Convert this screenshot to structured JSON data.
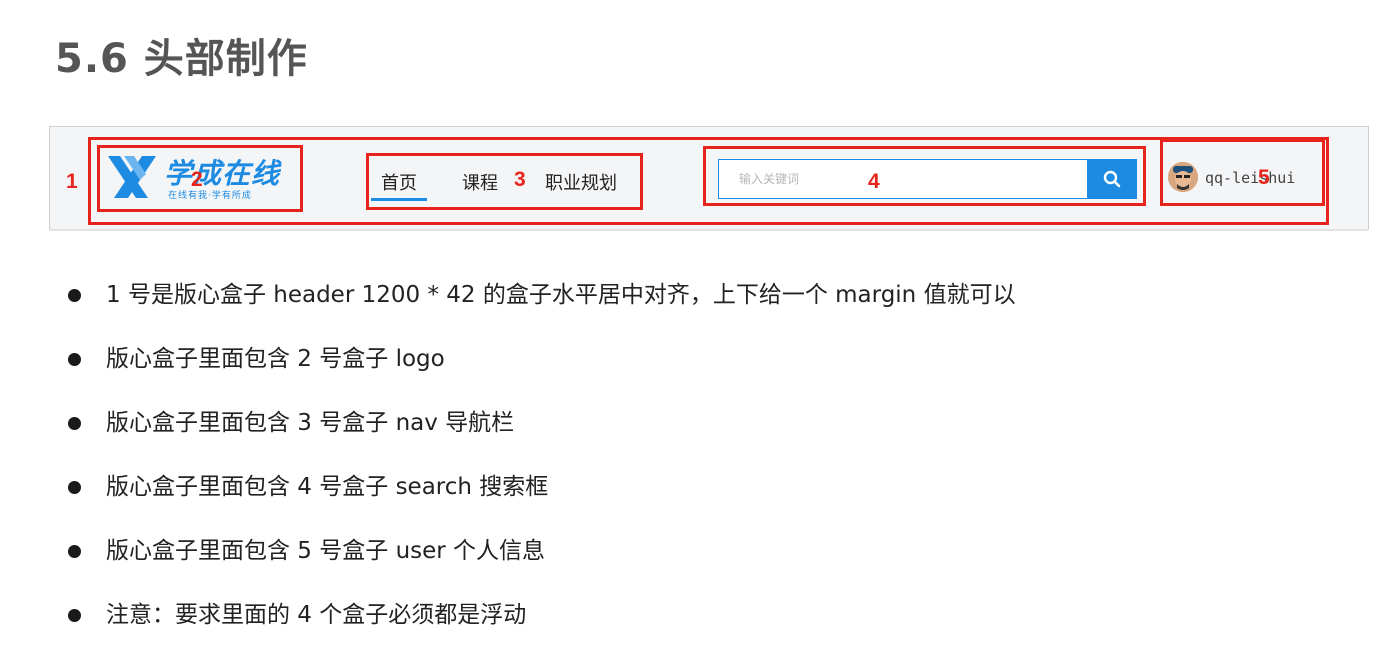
{
  "title": "5.6 头部制作",
  "demo": {
    "logo": {
      "main_text": "学成在线",
      "sub_text": "在线有我·学有所成"
    },
    "nav": [
      "首页",
      "课程",
      "职业规划"
    ],
    "search": {
      "placeholder": "输入关键词"
    },
    "user": {
      "name": "qq-leishui"
    },
    "labels": [
      "1",
      "2",
      "3",
      "4",
      "5"
    ],
    "colors": {
      "brand_blue": "#1e8be3",
      "annotation_red": "#e8231b"
    }
  },
  "bullets": [
    "1 号是版心盒子 header 1200 * 42 的盒子水平居中对齐，上下给一个 margin 值就可以",
    "版心盒子里面包含 2 号盒子 logo",
    "版心盒子里面包含 3 号盒子 nav 导航栏",
    "版心盒子里面包含 4 号盒子 search 搜索框",
    "版心盒子里面包含 5 号盒子 user 个人信息",
    "注意：要求里面的 4 个盒子必须都是浮动"
  ]
}
